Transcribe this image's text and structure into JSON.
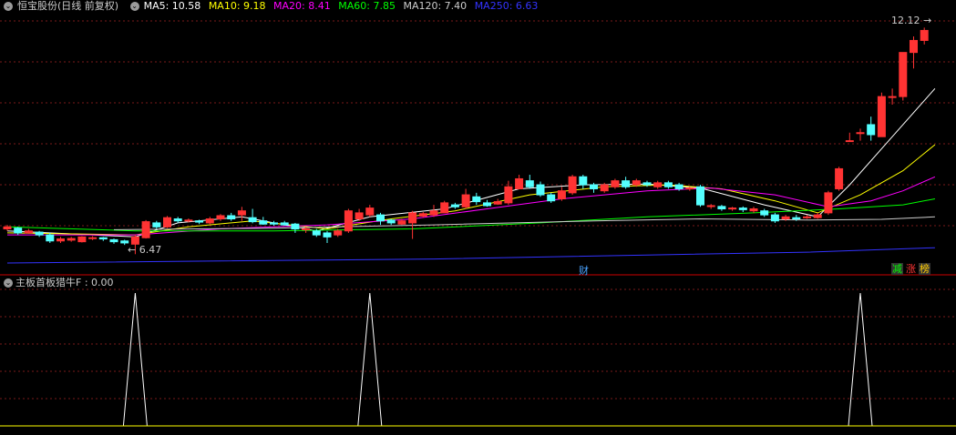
{
  "title": "恒宝股份(日线 前复权)",
  "ma_legend": [
    {
      "label": "MA5: 10.58",
      "color": "#ffffff"
    },
    {
      "label": "MA10: 9.18",
      "color": "#ffff00"
    },
    {
      "label": "MA20: 8.41",
      "color": "#ff00ff"
    },
    {
      "label": "MA60: 7.85",
      "color": "#00ff00"
    },
    {
      "label": "MA120: 7.40",
      "color": "#cccccc"
    },
    {
      "label": "MA250: 6.63",
      "color": "#3333ff"
    }
  ],
  "max_label": "12.12",
  "min_label": "6.47",
  "cai_label": "财",
  "tags": [
    {
      "text": "减",
      "color": "#00ff00",
      "bg": "#333"
    },
    {
      "text": "涨",
      "color": "#ff3333",
      "bg": "#000"
    },
    {
      "text": "榜",
      "color": "#ffcc00",
      "bg": "#333"
    }
  ],
  "indicator_label": "主板首板猎牛F : 0.00",
  "colors": {
    "up": "#ff3333",
    "down": "#54ffff",
    "grid": "#7a1a1a",
    "axis": "#cc0000"
  },
  "chart_data": {
    "type": "candlestick",
    "price_range": [
      6.0,
      12.4
    ],
    "candles": [
      [
        7.1,
        7.15,
        7.2,
        7.05
      ],
      [
        7.12,
        7.0,
        7.15,
        6.95
      ],
      [
        7.0,
        7.05,
        7.1,
        6.98
      ],
      [
        7.02,
        6.95,
        7.05,
        6.9
      ],
      [
        6.95,
        6.8,
        7.0,
        6.75
      ],
      [
        6.8,
        6.85,
        6.9,
        6.75
      ],
      [
        6.82,
        6.86,
        6.9,
        6.78
      ],
      [
        6.78,
        6.9,
        6.92,
        6.76
      ],
      [
        6.86,
        6.88,
        6.92,
        6.82
      ],
      [
        6.88,
        6.85,
        6.9,
        6.8
      ],
      [
        6.83,
        6.78,
        6.86,
        6.73
      ],
      [
        6.8,
        6.75,
        6.83,
        6.7
      ],
      [
        6.72,
        6.9,
        6.95,
        6.47
      ],
      [
        6.88,
        7.28,
        7.32,
        6.86
      ],
      [
        7.25,
        7.15,
        7.3,
        7.1
      ],
      [
        7.15,
        7.38,
        7.42,
        7.12
      ],
      [
        7.35,
        7.3,
        7.4,
        7.25
      ],
      [
        7.3,
        7.32,
        7.36,
        7.26
      ],
      [
        7.3,
        7.27,
        7.33,
        7.22
      ],
      [
        7.25,
        7.35,
        7.4,
        7.22
      ],
      [
        7.35,
        7.43,
        7.47,
        7.3
      ],
      [
        7.43,
        7.35,
        7.5,
        7.3
      ],
      [
        7.45,
        7.55,
        7.65,
        7.3
      ],
      [
        7.38,
        7.28,
        7.6,
        7.24
      ],
      [
        7.3,
        7.22,
        7.4,
        7.2
      ],
      [
        7.25,
        7.22,
        7.3,
        7.18
      ],
      [
        7.25,
        7.2,
        7.3,
        7.18
      ],
      [
        7.22,
        7.1,
        7.25,
        7.0
      ],
      [
        7.1,
        7.1,
        7.15,
        7.0
      ],
      [
        7.05,
        6.95,
        7.1,
        6.9
      ],
      [
        7.0,
        6.9,
        7.05,
        6.75
      ],
      [
        6.95,
        7.05,
        7.1,
        6.9
      ],
      [
        7.05,
        7.55,
        7.6,
        7.0
      ],
      [
        7.35,
        7.5,
        7.6,
        7.3
      ],
      [
        7.45,
        7.62,
        7.7,
        7.4
      ],
      [
        7.45,
        7.3,
        7.5,
        7.2
      ],
      [
        7.32,
        7.25,
        7.35,
        7.2
      ],
      [
        7.22,
        7.3,
        7.35,
        7.2
      ],
      [
        7.25,
        7.5,
        7.55,
        6.85
      ],
      [
        7.42,
        7.48,
        7.52,
        7.38
      ],
      [
        7.45,
        7.55,
        7.7,
        7.4
      ],
      [
        7.5,
        7.75,
        7.8,
        7.5
      ],
      [
        7.7,
        7.65,
        7.75,
        7.6
      ],
      [
        7.65,
        7.95,
        8.1,
        7.6
      ],
      [
        7.9,
        7.78,
        8.0,
        7.7
      ],
      [
        7.75,
        7.68,
        7.82,
        7.65
      ],
      [
        7.72,
        7.78,
        7.85,
        7.7
      ],
      [
        7.75,
        8.15,
        8.3,
        7.7
      ],
      [
        8.1,
        8.35,
        8.45,
        8.1
      ],
      [
        8.3,
        8.15,
        8.45,
        8.1
      ],
      [
        8.2,
        7.95,
        8.28,
        7.9
      ],
      [
        7.95,
        7.8,
        8.0,
        7.75
      ],
      [
        7.85,
        8.05,
        8.15,
        7.8
      ],
      [
        8.0,
        8.4,
        8.45,
        7.95
      ],
      [
        8.4,
        8.2,
        8.45,
        8.1
      ],
      [
        8.2,
        8.1,
        8.25,
        8.0
      ],
      [
        8.05,
        8.2,
        8.25,
        8.0
      ],
      [
        8.15,
        8.3,
        8.35,
        8.1
      ],
      [
        8.3,
        8.15,
        8.4,
        8.1
      ],
      [
        8.2,
        8.3,
        8.35,
        8.15
      ],
      [
        8.25,
        8.2,
        8.3,
        8.15
      ],
      [
        8.15,
        8.25,
        8.3,
        8.1
      ],
      [
        8.25,
        8.15,
        8.3,
        8.1
      ],
      [
        8.2,
        8.1,
        8.25,
        8.05
      ],
      [
        8.1,
        8.12,
        8.15,
        8.05
      ],
      [
        8.15,
        7.7,
        8.2,
        7.65
      ],
      [
        7.68,
        7.68,
        7.72,
        7.6
      ],
      [
        7.66,
        7.6,
        7.7,
        7.55
      ],
      [
        7.6,
        7.62,
        7.65,
        7.55
      ],
      [
        7.62,
        7.58,
        7.66,
        7.52
      ],
      [
        7.55,
        7.6,
        7.65,
        7.5
      ],
      [
        7.55,
        7.45,
        7.6,
        7.4
      ],
      [
        7.45,
        7.3,
        7.5,
        7.25
      ],
      [
        7.35,
        7.4,
        7.45,
        7.3
      ],
      [
        7.38,
        7.35,
        7.45,
        7.3
      ],
      [
        7.38,
        7.4,
        7.45,
        7.35
      ],
      [
        7.38,
        7.45,
        7.5,
        7.35
      ],
      [
        7.5,
        8.0,
        8.05,
        7.45
      ],
      [
        8.1,
        8.6,
        8.65,
        8.05
      ],
      [
        9.3,
        9.3,
        9.5,
        9.3
      ],
      [
        9.5,
        9.5,
        9.6,
        9.3
      ],
      [
        9.7,
        9.45,
        9.9,
        9.3
      ],
      [
        9.4,
        10.4,
        10.5,
        9.4
      ],
      [
        10.4,
        10.4,
        10.6,
        10.2
      ],
      [
        10.4,
        11.5,
        11.5,
        10.3
      ],
      [
        11.5,
        11.8,
        11.9,
        11.1
      ],
      [
        11.8,
        12.05,
        12.12,
        11.7
      ]
    ],
    "ma": {
      "MA5": {
        "color": "#ffffff",
        "points": [
          [
            0,
            7.05
          ],
          [
            12,
            6.9
          ],
          [
            16,
            7.25
          ],
          [
            22,
            7.4
          ],
          [
            29,
            7.05
          ],
          [
            34,
            7.4
          ],
          [
            41,
            7.6
          ],
          [
            48,
            8.1
          ],
          [
            54,
            8.2
          ],
          [
            60,
            8.22
          ],
          [
            65,
            8.12
          ],
          [
            71,
            7.7
          ],
          [
            76,
            7.4
          ],
          [
            79,
            8.2
          ],
          [
            83,
            9.4
          ],
          [
            87,
            10.6
          ]
        ]
      },
      "MA10": {
        "color": "#ffff00",
        "points": [
          [
            0,
            7.0
          ],
          [
            12,
            6.95
          ],
          [
            17,
            7.15
          ],
          [
            23,
            7.3
          ],
          [
            30,
            7.1
          ],
          [
            36,
            7.35
          ],
          [
            42,
            7.55
          ],
          [
            49,
            7.95
          ],
          [
            56,
            8.15
          ],
          [
            62,
            8.2
          ],
          [
            67,
            8.1
          ],
          [
            72,
            7.8
          ],
          [
            76,
            7.5
          ],
          [
            80,
            7.95
          ],
          [
            84,
            8.55
          ],
          [
            87,
            9.2
          ]
        ]
      },
      "MA20": {
        "color": "#ff00ff",
        "points": [
          [
            0,
            6.95
          ],
          [
            12,
            6.95
          ],
          [
            20,
            7.1
          ],
          [
            30,
            7.2
          ],
          [
            38,
            7.35
          ],
          [
            45,
            7.6
          ],
          [
            52,
            7.85
          ],
          [
            60,
            8.05
          ],
          [
            66,
            8.12
          ],
          [
            72,
            7.95
          ],
          [
            77,
            7.65
          ],
          [
            81,
            7.8
          ],
          [
            84,
            8.05
          ],
          [
            87,
            8.4
          ]
        ]
      },
      "MA60": {
        "color": "#00ff00",
        "points": [
          [
            0,
            7.15
          ],
          [
            12,
            7.05
          ],
          [
            25,
            7.05
          ],
          [
            38,
            7.1
          ],
          [
            50,
            7.25
          ],
          [
            60,
            7.4
          ],
          [
            70,
            7.5
          ],
          [
            78,
            7.6
          ],
          [
            84,
            7.7
          ],
          [
            87,
            7.85
          ]
        ]
      },
      "MA120": {
        "color": "#cccccc",
        "points": [
          [
            10,
            7.08
          ],
          [
            25,
            7.12
          ],
          [
            40,
            7.2
          ],
          [
            55,
            7.3
          ],
          [
            65,
            7.35
          ],
          [
            75,
            7.32
          ],
          [
            82,
            7.34
          ],
          [
            87,
            7.4
          ]
        ]
      },
      "MA250": {
        "color": "#3333ff",
        "points": [
          [
            0,
            6.25
          ],
          [
            20,
            6.3
          ],
          [
            40,
            6.35
          ],
          [
            60,
            6.45
          ],
          [
            75,
            6.52
          ],
          [
            87,
            6.63
          ]
        ]
      }
    },
    "indicator": {
      "spike_indices": [
        12,
        34,
        80
      ],
      "values": "0/1 pulses"
    }
  }
}
